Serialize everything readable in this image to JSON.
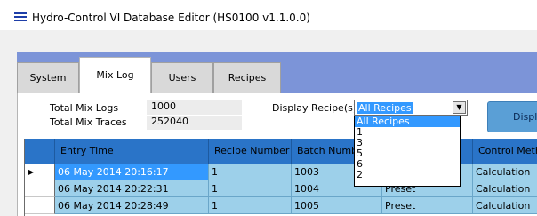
{
  "window": {
    "title": "Hydro-Control VI Database Editor (HS0100 v1.1.0.0)"
  },
  "tabs": [
    {
      "label": "System"
    },
    {
      "label": "Mix Log"
    },
    {
      "label": "Users"
    },
    {
      "label": "Recipes"
    }
  ],
  "summary": {
    "total_logs_label": "Total Mix Logs",
    "total_logs_value": "1000",
    "total_traces_label": "Total Mix Traces",
    "total_traces_value": "252040"
  },
  "recipe_filter": {
    "label": "Display Recipe(s)",
    "selected": "All Recipes",
    "options": [
      "All Recipes",
      "1",
      "3",
      "5",
      "6",
      "2"
    ]
  },
  "display_button": {
    "label": "Displ"
  },
  "grid": {
    "columns": [
      "Entry Time",
      "Recipe Number",
      "Batch Numb",
      "",
      "Control Metho"
    ],
    "rows": [
      {
        "entry_time": "06 May 2014 20:16:17",
        "recipe": "1",
        "batch": "1003",
        "mode": "",
        "control": "Calculation"
      },
      {
        "entry_time": "06 May 2014 20:22:31",
        "recipe": "1",
        "batch": "1004",
        "mode": "Preset",
        "control": "Calculation"
      },
      {
        "entry_time": "06 May 2014 20:28:49",
        "recipe": "1",
        "batch": "1005",
        "mode": "Preset",
        "control": "Calculation"
      }
    ]
  },
  "colors": {
    "tab_strip": "#7c94d8",
    "grid_header": "#2a74c8",
    "row_fill": "#9dd0ea",
    "selection": "#3399ff"
  }
}
